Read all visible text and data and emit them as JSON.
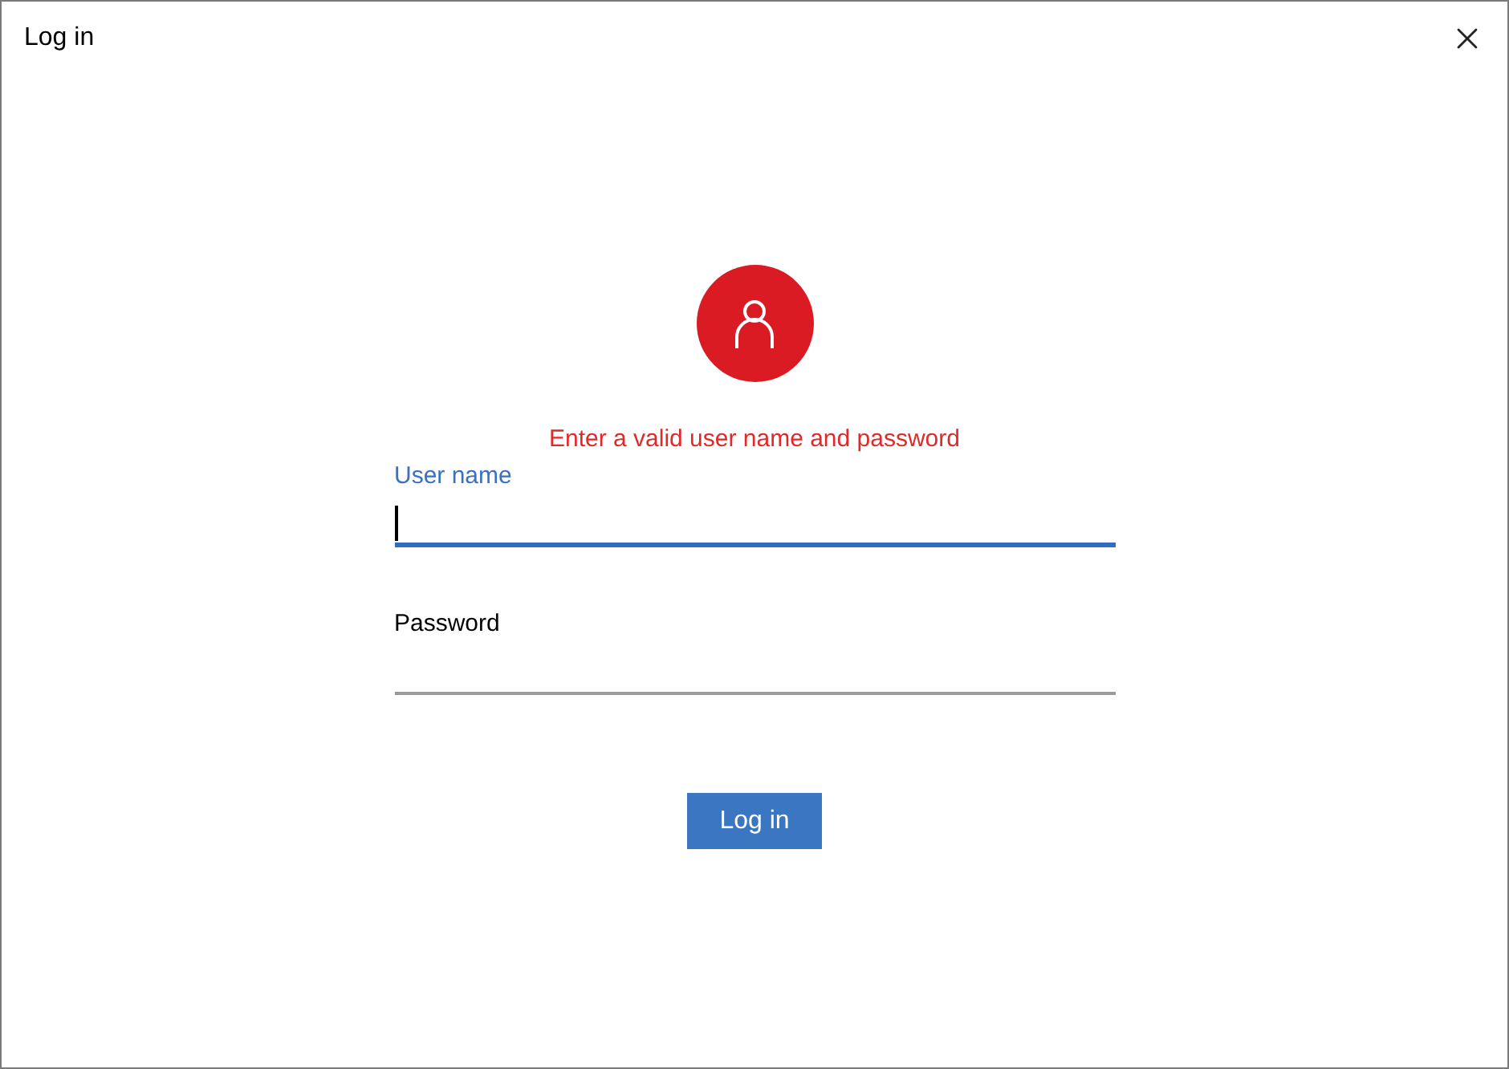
{
  "window": {
    "title": "Log in"
  },
  "error": "Enter a valid user name and password",
  "fields": [
    {
      "label": "User name",
      "focused": true
    },
    {
      "label": "Password",
      "focused": false
    }
  ],
  "button": "Log in"
}
